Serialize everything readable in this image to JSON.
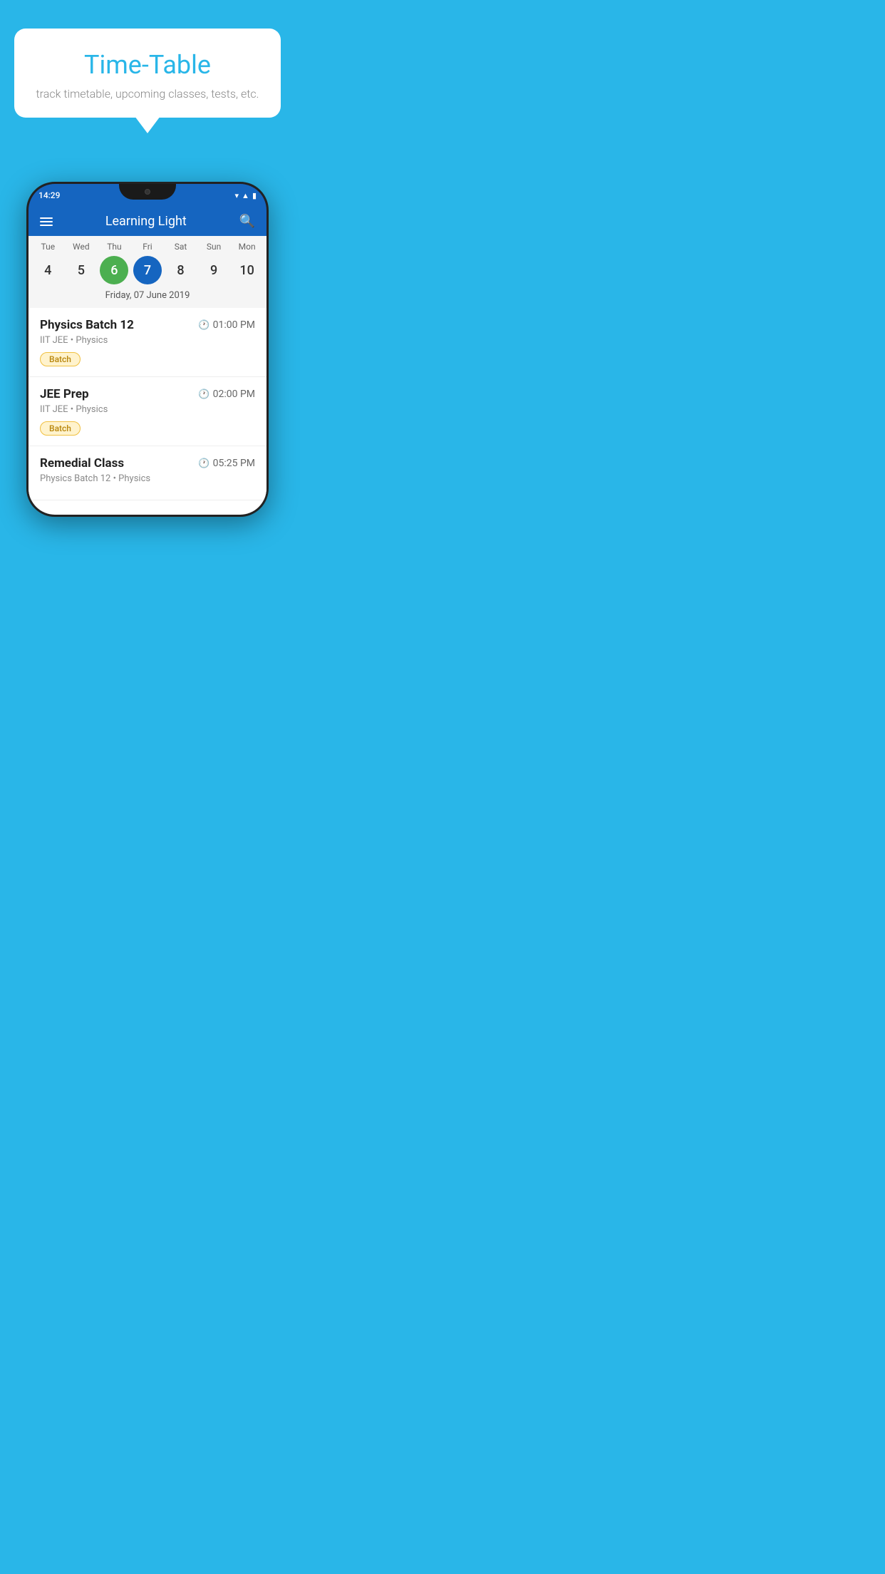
{
  "background_color": "#29B6E8",
  "speech_bubble": {
    "title": "Time-Table",
    "subtitle": "track timetable, upcoming classes, tests, etc."
  },
  "phone": {
    "status_bar": {
      "time": "14:29"
    },
    "app_header": {
      "title": "Learning Light"
    },
    "calendar": {
      "days": [
        "Tue",
        "Wed",
        "Thu",
        "Fri",
        "Sat",
        "Sun",
        "Mon"
      ],
      "dates": [
        "4",
        "5",
        "6",
        "7",
        "8",
        "9",
        "10"
      ],
      "today_index": 2,
      "selected_index": 3,
      "selected_label": "Friday, 07 June 2019"
    },
    "schedule": [
      {
        "title": "Physics Batch 12",
        "time": "01:00 PM",
        "subtitle": "IIT JEE • Physics",
        "tag": "Batch"
      },
      {
        "title": "JEE Prep",
        "time": "02:00 PM",
        "subtitle": "IIT JEE • Physics",
        "tag": "Batch"
      },
      {
        "title": "Remedial Class",
        "time": "05:25 PM",
        "subtitle": "Physics Batch 12 • Physics",
        "tag": null
      }
    ]
  }
}
